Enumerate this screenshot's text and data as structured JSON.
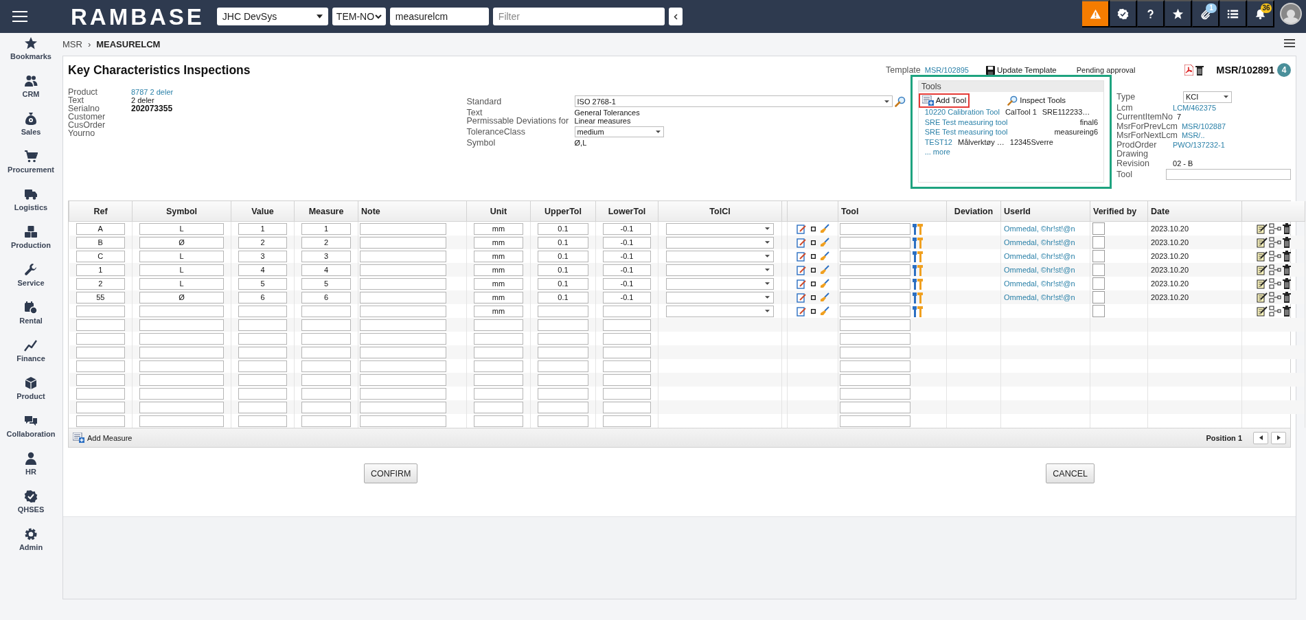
{
  "topbar": {
    "logo": "RAMBASE",
    "company": "JHC DevSys",
    "locale": "TEM-NO",
    "search": "measurelcm",
    "filter_placeholder": "Filter",
    "icons": [
      {
        "kind": "warning"
      },
      {
        "kind": "verified"
      },
      {
        "kind": "help"
      },
      {
        "kind": "star"
      },
      {
        "kind": "clip",
        "badge": "1"
      },
      {
        "kind": "list"
      },
      {
        "kind": "bell",
        "badge": "36"
      },
      {
        "kind": "avatar"
      }
    ]
  },
  "sidebar": {
    "items": [
      {
        "label": "Bookmarks",
        "kind": "star"
      },
      {
        "label": "CRM",
        "kind": "people"
      },
      {
        "label": "Sales",
        "kind": "moneybag"
      },
      {
        "label": "Procurement",
        "kind": "cart"
      },
      {
        "label": "Logistics",
        "kind": "truck"
      },
      {
        "label": "Production",
        "kind": "boxes"
      },
      {
        "label": "Service",
        "kind": "wrench"
      },
      {
        "label": "Rental",
        "kind": "calendar"
      },
      {
        "label": "Finance",
        "kind": "chart"
      },
      {
        "label": "Product",
        "kind": "box"
      },
      {
        "label": "Collaboration",
        "kind": "chat"
      },
      {
        "label": "HR",
        "kind": "person"
      },
      {
        "label": "QHSES",
        "kind": "badge"
      },
      {
        "label": "Admin",
        "kind": "gear"
      }
    ]
  },
  "breadcrumb": {
    "parent": "MSR",
    "separator": "›",
    "current": "MEASURELCM"
  },
  "title": "Key Characteristics Inspections",
  "status": {
    "template_label": "Template",
    "template": "MSR/102895",
    "update_template": "Update Template",
    "state": "Pending approval",
    "document": "MSR/102891",
    "badge": "4"
  },
  "product_info": [
    {
      "label": "Product",
      "value": "8787 2 deler",
      "kind": "link"
    },
    {
      "label": "Text",
      "value": "2 deler",
      "kind": "text"
    },
    {
      "label": "Serialno",
      "value": "202073355",
      "kind": "bold"
    },
    {
      "label": "Customer",
      "kind": "text"
    },
    {
      "label": "CusOrder",
      "kind": "text"
    },
    {
      "label": "Yourno",
      "kind": "text"
    }
  ],
  "standard_info": [
    {
      "label": "Standard",
      "value": "ISO 2768-1",
      "kind": "select"
    },
    {
      "label": "Text",
      "value": "General Tolerances",
      "kind": "text"
    },
    {
      "label": "Permissable Deviations for",
      "value": "Linear measures",
      "kind": "text"
    },
    {
      "label": "ToleranceClass",
      "value": "medium",
      "kind": "select"
    },
    {
      "label": "Symbol",
      "value": "Ø,L",
      "kind": "text"
    }
  ],
  "tools": {
    "title": "Tools",
    "highlighted": true,
    "add": {
      "label": "Add Tool",
      "highlighted": true
    },
    "inspect": "Inspect Tools",
    "items": [
      {
        "name": "10220 Calibration Tool",
        "code": "CalTool 1",
        "serial": "SRE112233…"
      },
      {
        "name": "SRE Test measuring tool",
        "serial": "final6"
      },
      {
        "name": "SRE Test measuring tool",
        "serial": "measureing6"
      },
      {
        "name": "TEST12",
        "code": "Målverktøy …",
        "serial": "12345Sverre"
      }
    ],
    "more": "... more"
  },
  "order_info": [
    {
      "label": "Type",
      "value": "KCI",
      "kind": "select"
    },
    {
      "label": "Lcm",
      "value": "LCM/462375",
      "kind": "link"
    },
    {
      "label": "CurrentItemNo",
      "value": "7",
      "kind": "text"
    },
    {
      "label": "MsrForPrevLcm",
      "value": "MSR/102887",
      "kind": "link"
    },
    {
      "label": "MsrForNextLcm",
      "value": "MSR/..",
      "kind": "link"
    },
    {
      "label": "ProdOrder",
      "value": "PWO/137232-1",
      "kind": "link"
    },
    {
      "label": "Drawing",
      "kind": "text"
    },
    {
      "label": "Revision",
      "value": "02 - B",
      "kind": "text"
    },
    {
      "label": "Tool",
      "kind": "input"
    }
  ],
  "table": {
    "columns": [
      "Ref",
      "Symbol",
      "Value",
      "Measure",
      "Note",
      "Unit",
      "UpperTol",
      "LowerTol",
      "TolCl",
      "Tool",
      "Deviation",
      "UserId",
      "Verified by",
      "Date"
    ],
    "rows": [
      {
        "kind": "entry",
        "ref": "A",
        "symbol": "L",
        "value": "1",
        "measure": "1",
        "unit": "mm",
        "upper_tol": "0.1",
        "lower_tol": "-0.1",
        "user_id": "Ommedal, ©hr!st!@n",
        "verified": false,
        "date": "2023.10.20"
      },
      {
        "kind": "entry",
        "ref": "B",
        "symbol": "Ø",
        "value": "2",
        "measure": "2",
        "unit": "mm",
        "upper_tol": "0.1",
        "lower_tol": "-0.1",
        "user_id": "Ommedal, ©hr!st!@n",
        "verified": false,
        "date": "2023.10.20"
      },
      {
        "kind": "entry",
        "ref": "C",
        "symbol": "L",
        "value": "3",
        "measure": "3",
        "unit": "mm",
        "upper_tol": "0.1",
        "lower_tol": "-0.1",
        "user_id": "Ommedal, ©hr!st!@n",
        "verified": false,
        "date": "2023.10.20"
      },
      {
        "kind": "entry",
        "ref": "1",
        "symbol": "L",
        "value": "4",
        "measure": "4",
        "unit": "mm",
        "upper_tol": "0.1",
        "lower_tol": "-0.1",
        "user_id": "Ommedal, ©hr!st!@n",
        "verified": false,
        "date": "2023.10.20"
      },
      {
        "kind": "entry",
        "ref": "2",
        "symbol": "L",
        "value": "5",
        "measure": "5",
        "unit": "mm",
        "upper_tol": "0.1",
        "lower_tol": "-0.1",
        "user_id": "Ommedal, ©hr!st!@n",
        "verified": false,
        "date": "2023.10.20"
      },
      {
        "kind": "entry",
        "ref": "55",
        "symbol": "Ø",
        "value": "6",
        "measure": "6",
        "unit": "mm",
        "upper_tol": "0.1",
        "lower_tol": "-0.1",
        "user_id": "Ommedal, ©hr!st!@n",
        "verified": false,
        "date": "2023.10.20"
      },
      {
        "kind": "entry",
        "unit": "mm",
        "verified": false
      },
      {
        "kind": "blank"
      },
      {
        "kind": "blank"
      },
      {
        "kind": "blank"
      },
      {
        "kind": "blank"
      },
      {
        "kind": "blank"
      },
      {
        "kind": "blank"
      },
      {
        "kind": "blank"
      },
      {
        "kind": "blank"
      }
    ],
    "add_measure": "Add Measure",
    "position": "Position 1"
  },
  "buttons": {
    "confirm": "CONFIRM",
    "cancel": "CANCEL"
  }
}
